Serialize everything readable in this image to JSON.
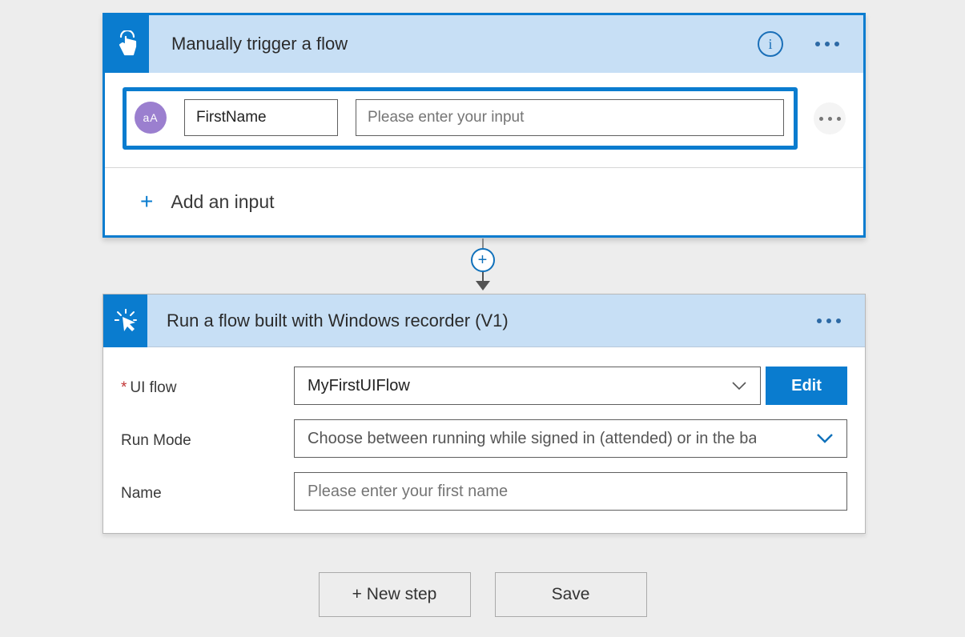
{
  "trigger": {
    "title": "Manually trigger a flow",
    "input": {
      "type_badge": "aA",
      "name": "FirstName",
      "placeholder": "Please enter your input"
    },
    "add_label": "Add an input"
  },
  "action": {
    "title": "Run a flow built with Windows recorder (V1)",
    "fields": {
      "ui_flow": {
        "label": "UI flow",
        "value": "MyFirstUIFlow",
        "edit": "Edit"
      },
      "run_mode": {
        "label": "Run Mode",
        "placeholder": "Choose between running while signed in (attended) or in the background"
      },
      "name": {
        "label": "Name",
        "placeholder": "Please enter your first name"
      }
    }
  },
  "footer": {
    "new_step": "+ New step",
    "save": "Save"
  },
  "connector": {
    "plus": "+"
  }
}
